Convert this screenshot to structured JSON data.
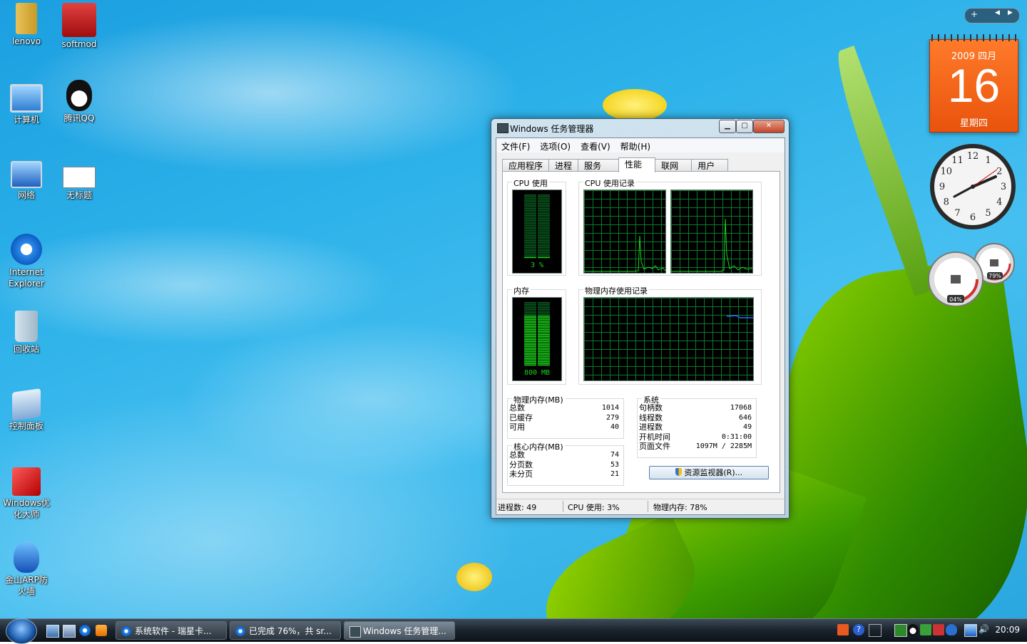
{
  "desktop_icons": [
    {
      "label": "lenovo"
    },
    {
      "label": "softmod"
    },
    {
      "label": "计算机"
    },
    {
      "label": "腾讯QQ"
    },
    {
      "label": "网络"
    },
    {
      "label": "无标题"
    },
    {
      "label": "Internet Explorer"
    },
    {
      "label": "回收站"
    },
    {
      "label": "控制面板"
    },
    {
      "label": "Windows优化大师"
    },
    {
      "label": "金山ARP防火墙"
    }
  ],
  "window": {
    "title": "Windows 任务管理器",
    "menu": [
      "文件(F)",
      "选项(O)",
      "查看(V)",
      "帮助(H)"
    ],
    "tabs": [
      "应用程序",
      "进程",
      "服务",
      "性能",
      "联网",
      "用户"
    ],
    "active_tab": "性能",
    "cpu_usage_label": "CPU 使用",
    "cpu_usage_value": "3 %",
    "cpu_history_label": "CPU 使用记录",
    "mem_label": "内存",
    "mem_value": "800 MB",
    "mem_history_label": "物理内存使用记录",
    "cpu_percent": 3,
    "mem_fraction": 0.78,
    "physical_mem": {
      "title": "物理内存(MB)",
      "rows": [
        {
          "label": "总数",
          "value": "1014"
        },
        {
          "label": "已缓存",
          "value": "279"
        },
        {
          "label": "可用",
          "value": "40"
        }
      ]
    },
    "kernel_mem": {
      "title": "核心内存(MB)",
      "rows": [
        {
          "label": "总数",
          "value": "74"
        },
        {
          "label": "分页数",
          "value": "53"
        },
        {
          "label": "未分页",
          "value": "21"
        }
      ]
    },
    "system": {
      "title": "系统",
      "rows": [
        {
          "label": "句柄数",
          "value": "17068"
        },
        {
          "label": "线程数",
          "value": "646"
        },
        {
          "label": "进程数",
          "value": "49"
        },
        {
          "label": "开机时间",
          "value": "0:31:00"
        },
        {
          "label": "页面文件",
          "value": "1097M / 2285M"
        }
      ]
    },
    "resource_monitor_button": "资源监视器(R)...",
    "status": {
      "processes": "进程数: 49",
      "cpu": "CPU 使用: 3%",
      "memory": "物理内存: 78%"
    }
  },
  "gadgets": {
    "calendar": {
      "year_month": "2009 四月",
      "day": "16",
      "weekday": "星期四"
    },
    "clock_numbers": [
      "12",
      "1",
      "2",
      "3",
      "4",
      "5",
      "6",
      "7",
      "8",
      "9",
      "10",
      "11"
    ],
    "meter_left": "04%",
    "meter_right": "79%"
  },
  "taskbar": {
    "buttons": [
      {
        "label": "系统软件 - 瑞星卡..."
      },
      {
        "label": "已完成 76%，共 sr..."
      },
      {
        "label": "Windows 任务管理..."
      }
    ],
    "time": "20:09"
  },
  "colors": {
    "graph_green": "#1bd61b",
    "grid_green": "#0b7a2a",
    "mem_line": "#2a6cff",
    "calendar_orange": "#f26a1b"
  }
}
